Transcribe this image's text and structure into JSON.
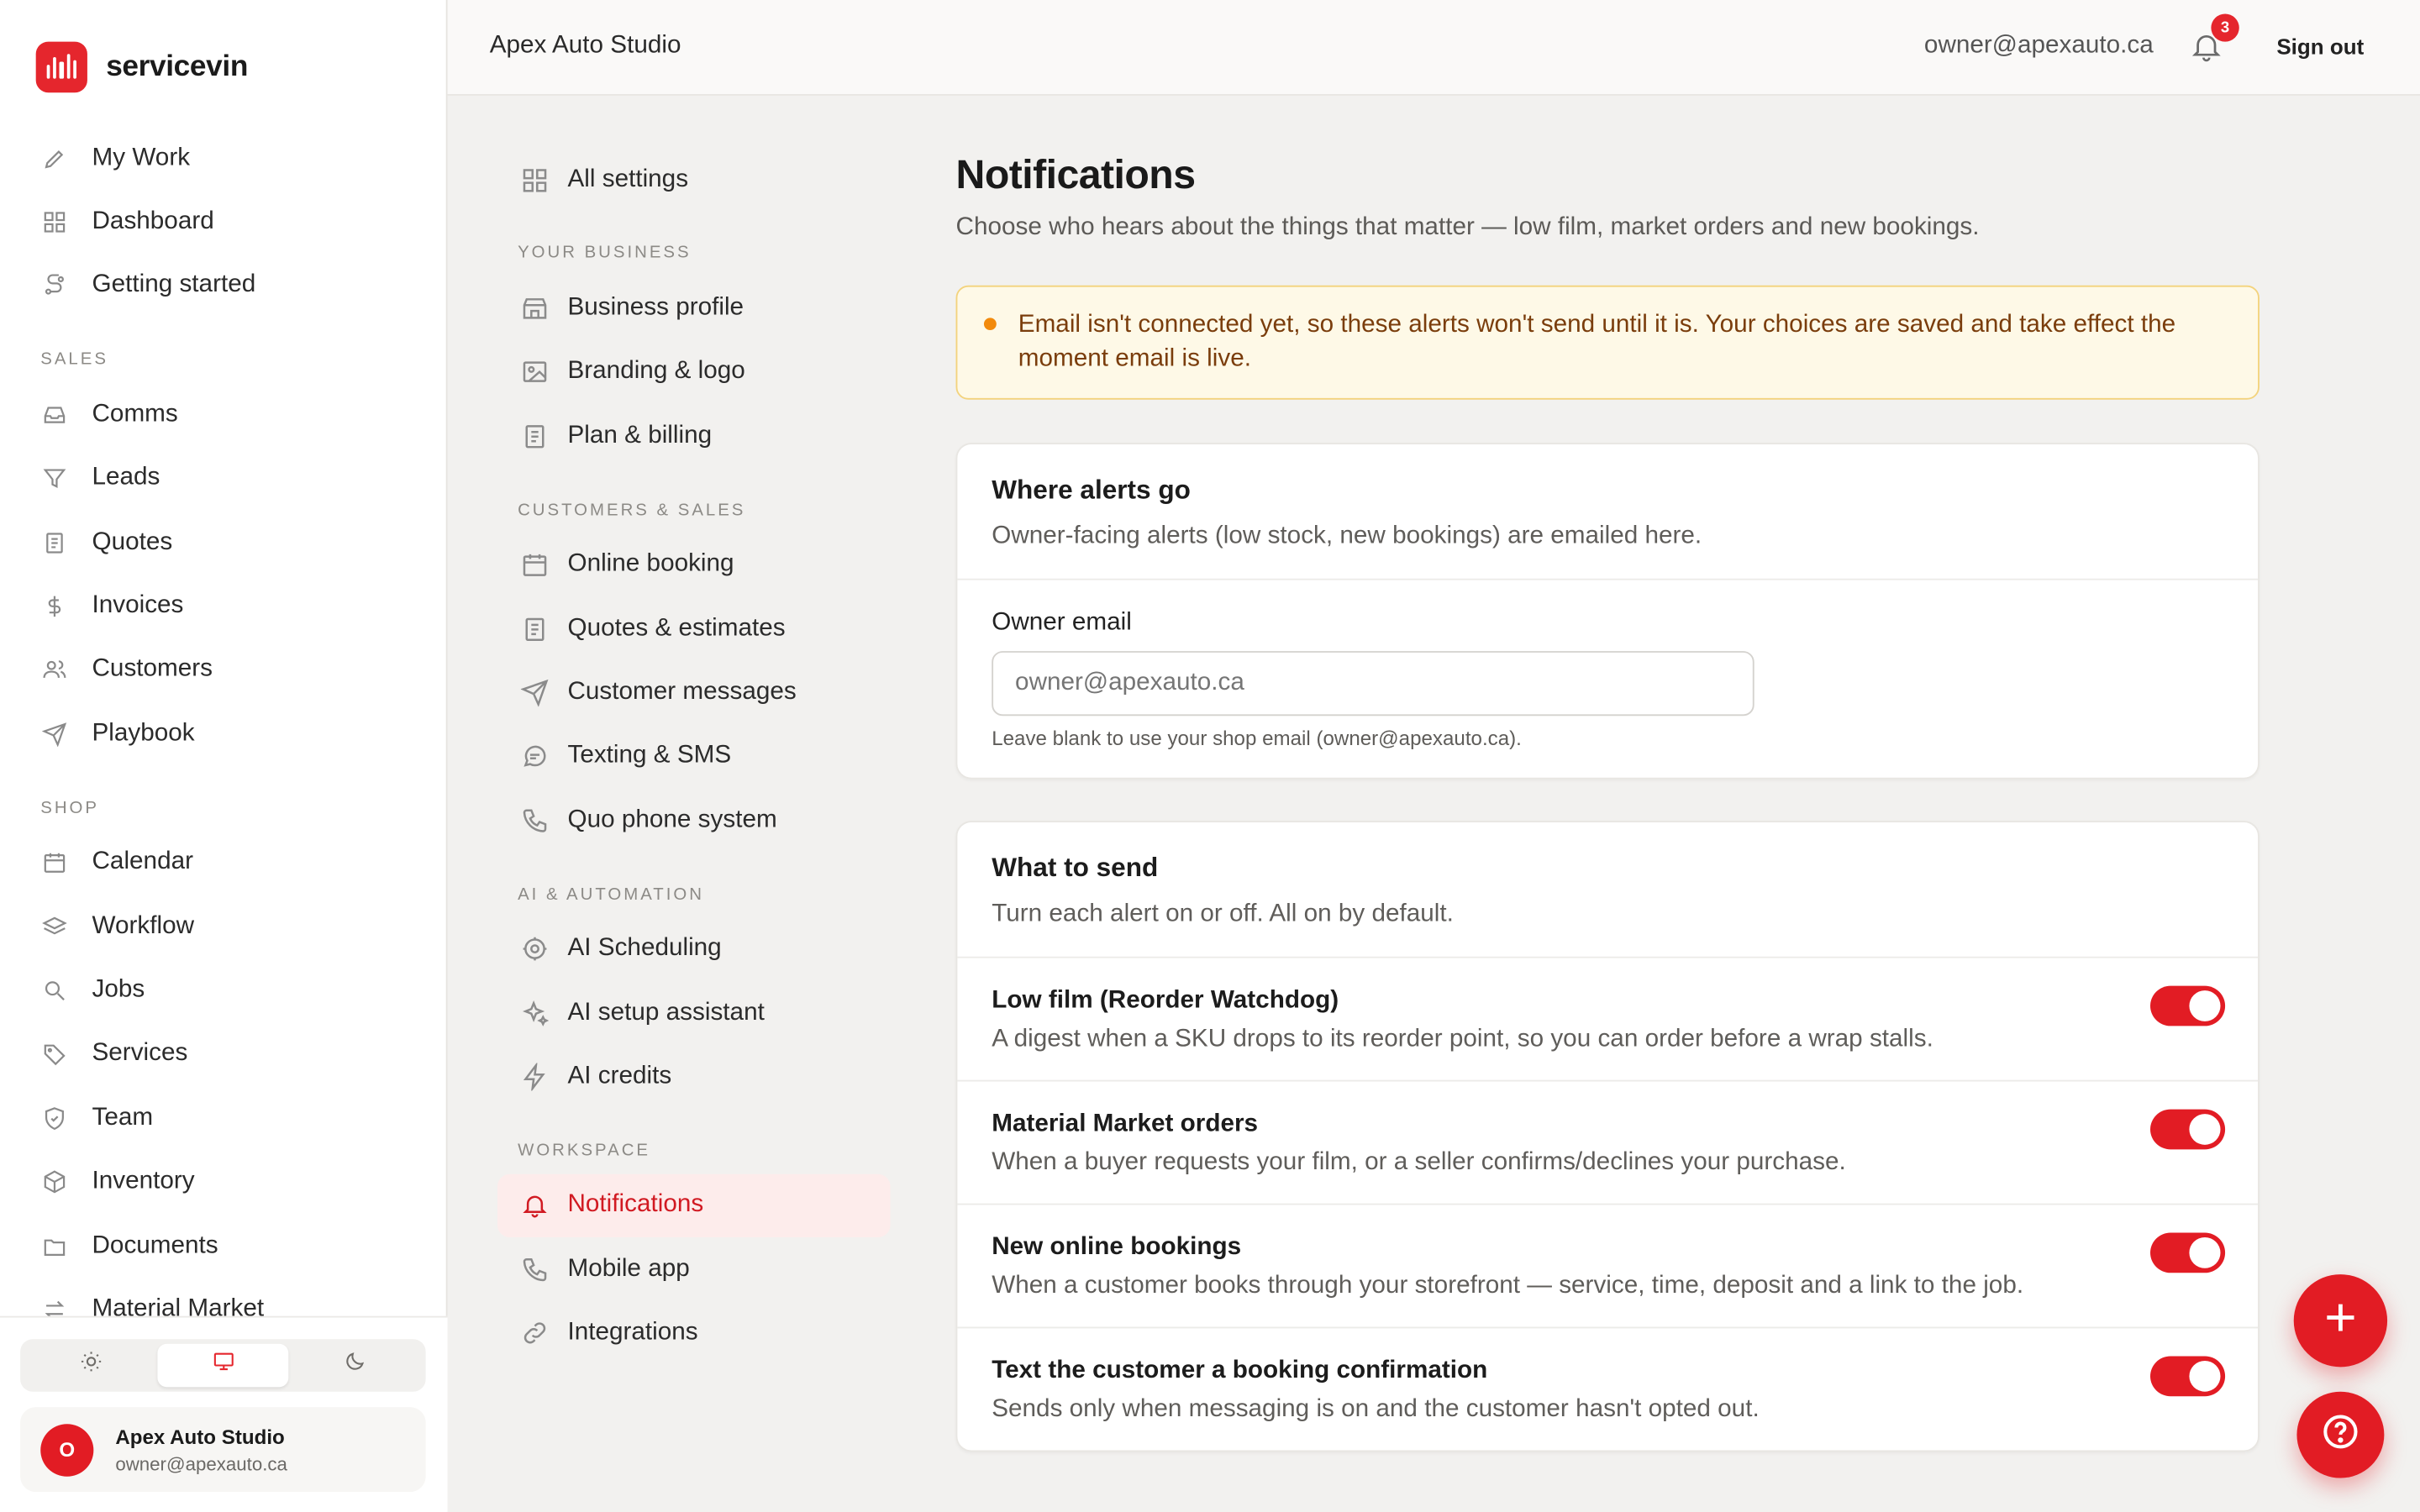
{
  "brand": {
    "name": "servicevin"
  },
  "sidebar": {
    "items_top": [
      {
        "label": "My Work",
        "icon": "pen-icon"
      },
      {
        "label": "Dashboard",
        "icon": "grid-icon"
      },
      {
        "label": "Getting started",
        "icon": "route-icon"
      }
    ],
    "sections": [
      {
        "title": "SALES",
        "items": [
          {
            "label": "Comms",
            "icon": "inbox-icon"
          },
          {
            "label": "Leads",
            "icon": "funnel-icon"
          },
          {
            "label": "Quotes",
            "icon": "document-icon"
          },
          {
            "label": "Invoices",
            "icon": "dollar-icon"
          },
          {
            "label": "Customers",
            "icon": "users-icon"
          },
          {
            "label": "Playbook",
            "icon": "send-icon"
          }
        ]
      },
      {
        "title": "SHOP",
        "items": [
          {
            "label": "Calendar",
            "icon": "calendar-icon"
          },
          {
            "label": "Workflow",
            "icon": "layers-icon"
          },
          {
            "label": "Jobs",
            "icon": "search-icon"
          },
          {
            "label": "Services",
            "icon": "tag-icon"
          },
          {
            "label": "Team",
            "icon": "shield-icon"
          },
          {
            "label": "Inventory",
            "icon": "box-icon"
          },
          {
            "label": "Documents",
            "icon": "folder-icon"
          },
          {
            "label": "Material Market",
            "icon": "swap-icon"
          }
        ]
      }
    ],
    "user": {
      "initial": "O",
      "name": "Apex Auto Studio",
      "email": "owner@apexauto.ca"
    }
  },
  "topbar": {
    "title": "Apex Auto Studio",
    "email": "owner@apexauto.ca",
    "notification_count": "3",
    "signout": "Sign out"
  },
  "settings_nav": {
    "all": "All settings",
    "sections": [
      {
        "title": "YOUR BUSINESS",
        "items": [
          "Business profile",
          "Branding & logo",
          "Plan & billing"
        ]
      },
      {
        "title": "CUSTOMERS & SALES",
        "items": [
          "Online booking",
          "Quotes & estimates",
          "Customer messages",
          "Texting & SMS",
          "Quo phone system"
        ]
      },
      {
        "title": "AI & AUTOMATION",
        "items": [
          "AI Scheduling",
          "AI setup assistant",
          "AI credits"
        ]
      },
      {
        "title": "WORKSPACE",
        "items": [
          "Notifications",
          "Mobile app",
          "Integrations"
        ]
      }
    ],
    "active": "Notifications"
  },
  "main": {
    "title": "Notifications",
    "subtitle": "Choose who hears about the things that matter — low film, market orders and new bookings.",
    "alert": "Email isn't connected yet, so these alerts won't send until it is. Your choices are saved and take effect the moment email is live.",
    "where": {
      "title": "Where alerts go",
      "desc": "Owner-facing alerts (low stock, new bookings) are emailed here.",
      "field_label": "Owner email",
      "placeholder": "owner@apexauto.ca",
      "hint": "Leave blank to use your shop email (owner@apexauto.ca)."
    },
    "what": {
      "title": "What to send",
      "desc": "Turn each alert on or off. All on by default.",
      "toggles": [
        {
          "title": "Low film (Reorder Watchdog)",
          "desc": "A digest when a SKU drops to its reorder point, so you can order before a wrap stalls.",
          "on": true
        },
        {
          "title": "Material Market orders",
          "desc": "When a buyer requests your film, or a seller confirms/declines your purchase.",
          "on": true
        },
        {
          "title": "New online bookings",
          "desc": "When a customer books through your storefront — service, time, deposit and a link to the job.",
          "on": true
        },
        {
          "title": "Text the customer a booking confirmation",
          "desc": "Sends only when messaging is on and the customer hasn't opted out.",
          "on": true
        }
      ]
    }
  },
  "colors": {
    "accent": "#e21c24",
    "alert_bg": "#fef9e7",
    "alert_text": "#7a3d0c"
  }
}
